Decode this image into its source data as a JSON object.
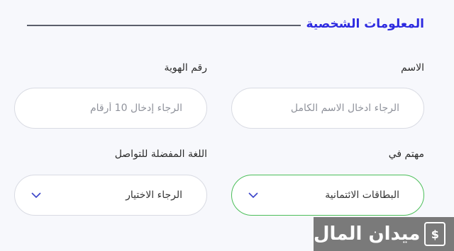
{
  "section": {
    "title": "المعلومات الشخصية"
  },
  "form": {
    "name": {
      "label": "الاسم",
      "placeholder": "الرجاء ادخال الاسم الكامل",
      "value": ""
    },
    "id_number": {
      "label": "رقم الهوية",
      "placeholder": "الرجاء إدخال 10 أرقام",
      "value": ""
    },
    "interested_in": {
      "label": "مهتم في",
      "selected": "البطاقات الائتمانية"
    },
    "language": {
      "label": "اللغة المفضلة للتواصل",
      "selected": "الرجاء الاختيار"
    }
  },
  "watermark": {
    "text": "ميدان المال",
    "icon": "dollar-badge-icon"
  },
  "colors": {
    "accent": "#2d2ae0",
    "active_border": "#4cbf5a",
    "chevron": "#3a43c9"
  }
}
